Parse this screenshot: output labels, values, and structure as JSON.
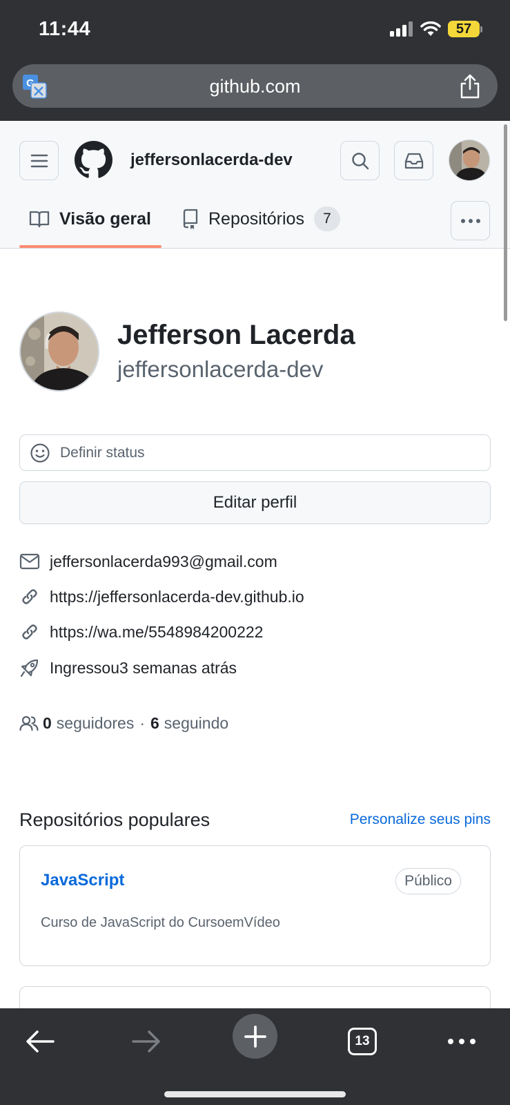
{
  "status_bar": {
    "time": "11:44",
    "battery": "57"
  },
  "browser": {
    "url": "github.com",
    "tab_count": "13"
  },
  "header": {
    "username": "jeffersonlacerda-dev"
  },
  "tabs": [
    {
      "label": "Visão geral",
      "active": true
    },
    {
      "label": "Repositórios",
      "count": "7",
      "active": false
    }
  ],
  "profile": {
    "full_name": "Jefferson Lacerda",
    "login": "jeffersonlacerda-dev",
    "status_placeholder": "Definir status",
    "edit_button": "Editar perfil",
    "email": "jeffersonlacerda993@gmail.com",
    "website": "https://jeffersonlacerda-dev.github.io",
    "whatsapp": "https://wa.me/5548984200222",
    "joined": "Ingressou3 semanas atrás",
    "followers_count": "0",
    "followers_label": "seguidores",
    "separator": "·",
    "following_count": "6",
    "following_label": "seguindo"
  },
  "popular": {
    "title": "Repositórios populares",
    "customize": "Personalize seus pins",
    "repos": [
      {
        "name": "JavaScript",
        "visibility": "Público",
        "description": "Curso de JavaScript do CursoemVídeo"
      }
    ]
  },
  "colors": {
    "accent": "#0969da",
    "tab_underline": "#fd8c73",
    "battery": "#f4d83a",
    "chrome": "#2f3134"
  },
  "icons": [
    "translate-icon",
    "share-icon",
    "hamburger-icon",
    "github-logo-icon",
    "search-icon",
    "inbox-icon",
    "book-icon",
    "repo-icon",
    "kebab-icon",
    "smiley-icon",
    "mail-icon",
    "link-icon",
    "rocket-icon",
    "people-icon",
    "back-arrow-icon",
    "forward-arrow-icon",
    "plus-icon",
    "more-icon"
  ]
}
